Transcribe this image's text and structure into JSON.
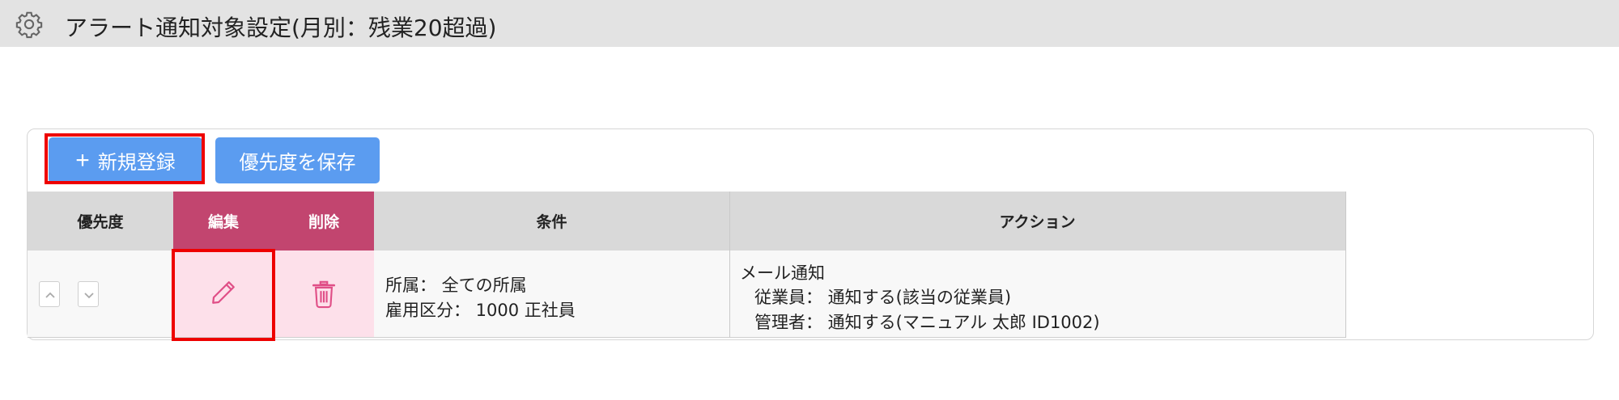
{
  "header": {
    "title": "アラート通知対象設定(月別：残業20超過)",
    "icon": "gear-icon"
  },
  "toolbar": {
    "new_plus": "+",
    "new_label": "新規登録",
    "save_priority_label": "優先度を保存"
  },
  "table": {
    "headers": {
      "priority": "優先度",
      "edit": "編集",
      "delete": "削除",
      "condition": "条件",
      "action": "アクション"
    },
    "rows": [
      {
        "condition_line1": "所属：  全ての所属",
        "condition_line2": "雇用区分：  1000 正社員",
        "action_line1": "メール通知",
        "action_line2": "従業員：  通知する(該当の従業員)",
        "action_line3": "管理者：  通知する(マニュアル  太郎  ID1002)"
      }
    ]
  },
  "colors": {
    "header_bg": "#e3e3e3",
    "button_blue": "#5b9cf0",
    "pink_header": "#c2456f",
    "pink_cell": "#fde0ea",
    "pink_icon": "#e04f87",
    "highlight_red": "#ee0000"
  },
  "icons": {
    "edit": "pencil-icon",
    "delete": "trash-icon",
    "up": "chevron-up-icon",
    "down": "chevron-down-icon"
  }
}
